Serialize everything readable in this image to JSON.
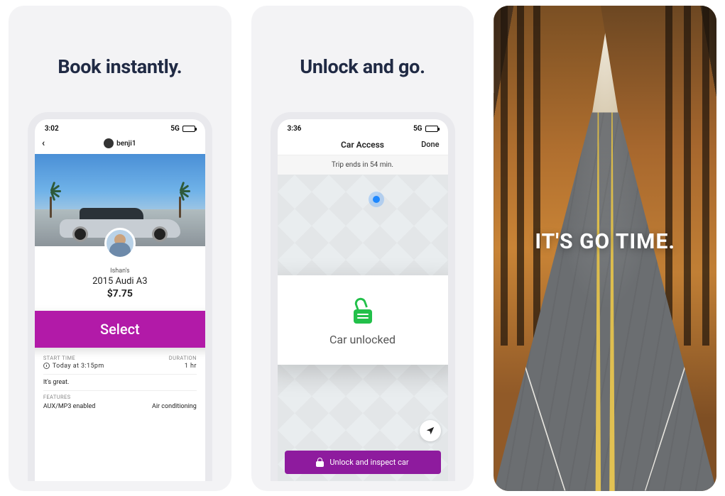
{
  "panels": [
    {
      "headline": "Book instantly."
    },
    {
      "headline": "Unlock and go."
    },
    {
      "overlay": "IT'S GO TIME."
    }
  ],
  "listing": {
    "status_time": "3:02",
    "status_signal": "5G",
    "host_handle": "benji1",
    "owner_name": "Ishan's",
    "car_title": "2015 Audi A3",
    "price": "$7.75",
    "select_label": "Select",
    "start_label": "START TIME",
    "duration_label": "DURATION",
    "start_value": "Today at 3:15pm",
    "duration_value": "1 hr",
    "note": "It's great.",
    "features_label": "FEATURES",
    "feature_1": "AUX/MP3 enabled",
    "feature_2": "Air conditioning"
  },
  "unlock": {
    "status_time": "3:36",
    "status_signal": "5G",
    "nav_title": "Car Access",
    "nav_done": "Done",
    "trip_timer": "Trip ends in 54 min.",
    "toast_text": "Car unlocked",
    "button_label": "Unlock and inspect car"
  }
}
